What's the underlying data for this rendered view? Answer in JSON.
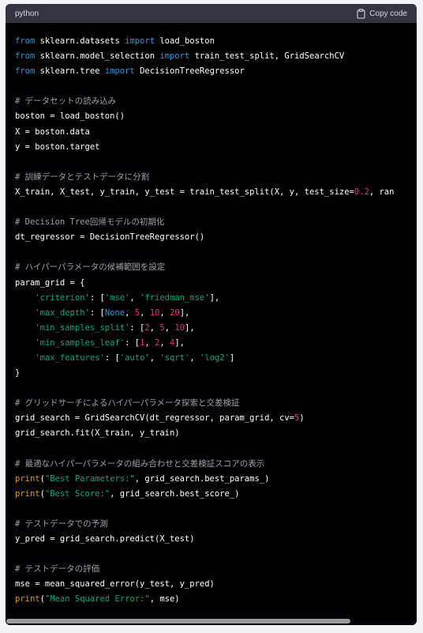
{
  "header": {
    "language": "python",
    "copy_label": "Copy code"
  },
  "colors": {
    "keyword": "#2e95d3",
    "string": "#00a67d",
    "number": "#df3079",
    "comment": "#a0a0aa",
    "builtin": "#e9950c",
    "text": "#ffffff",
    "header_bg": "#343541",
    "code_bg": "#000000"
  },
  "icons": {
    "copy": "clipboard-icon"
  },
  "code": {
    "lines": [
      [
        [
          "kw",
          "from"
        ],
        [
          "t",
          " sklearn.datasets "
        ],
        [
          "kw",
          "import"
        ],
        [
          "t",
          " load_boston"
        ]
      ],
      [
        [
          "kw",
          "from"
        ],
        [
          "t",
          " sklearn.model_selection "
        ],
        [
          "kw",
          "import"
        ],
        [
          "t",
          " train_test_split, GridSearchCV"
        ]
      ],
      [
        [
          "kw",
          "from"
        ],
        [
          "t",
          " sklearn.tree "
        ],
        [
          "kw",
          "import"
        ],
        [
          "t",
          " DecisionTreeRegressor"
        ]
      ],
      [],
      [
        [
          "cmt",
          "# データセットの読み込み"
        ]
      ],
      [
        [
          "t",
          "boston = load_boston()"
        ]
      ],
      [
        [
          "t",
          "X = boston.data"
        ]
      ],
      [
        [
          "t",
          "y = boston.target"
        ]
      ],
      [],
      [
        [
          "cmt",
          "# 訓練データとテストデータに分割"
        ]
      ],
      [
        [
          "t",
          "X_train, X_test, y_train, y_test = train_test_split(X, y, test_size="
        ],
        [
          "num",
          "0.2"
        ],
        [
          "t",
          ", ran"
        ]
      ],
      [],
      [
        [
          "cmt",
          "# Decision Tree回帰モデルの初期化"
        ]
      ],
      [
        [
          "t",
          "dt_regressor = DecisionTreeRegressor()"
        ]
      ],
      [],
      [
        [
          "cmt",
          "# ハイパーパラメータの候補範囲を設定"
        ]
      ],
      [
        [
          "t",
          "param_grid = {"
        ]
      ],
      [
        [
          "t",
          "    "
        ],
        [
          "str",
          "'criterion'"
        ],
        [
          "t",
          ": ["
        ],
        [
          "str",
          "'mse'"
        ],
        [
          "t",
          ", "
        ],
        [
          "str",
          "'friedman_mse'"
        ],
        [
          "t",
          "],"
        ]
      ],
      [
        [
          "t",
          "    "
        ],
        [
          "str",
          "'max_depth'"
        ],
        [
          "t",
          ": ["
        ],
        [
          "kw",
          "None"
        ],
        [
          "t",
          ", "
        ],
        [
          "num",
          "5"
        ],
        [
          "t",
          ", "
        ],
        [
          "num",
          "10"
        ],
        [
          "t",
          ", "
        ],
        [
          "num",
          "20"
        ],
        [
          "t",
          "],"
        ]
      ],
      [
        [
          "t",
          "    "
        ],
        [
          "str",
          "'min_samples_split'"
        ],
        [
          "t",
          ": ["
        ],
        [
          "num",
          "2"
        ],
        [
          "t",
          ", "
        ],
        [
          "num",
          "5"
        ],
        [
          "t",
          ", "
        ],
        [
          "num",
          "10"
        ],
        [
          "t",
          "],"
        ]
      ],
      [
        [
          "t",
          "    "
        ],
        [
          "str",
          "'min_samples_leaf'"
        ],
        [
          "t",
          ": ["
        ],
        [
          "num",
          "1"
        ],
        [
          "t",
          ", "
        ],
        [
          "num",
          "2"
        ],
        [
          "t",
          ", "
        ],
        [
          "num",
          "4"
        ],
        [
          "t",
          "],"
        ]
      ],
      [
        [
          "t",
          "    "
        ],
        [
          "str",
          "'max_features'"
        ],
        [
          "t",
          ": ["
        ],
        [
          "str",
          "'auto'"
        ],
        [
          "t",
          ", "
        ],
        [
          "str",
          "'sqrt'"
        ],
        [
          "t",
          ", "
        ],
        [
          "str",
          "'log2'"
        ],
        [
          "t",
          "]"
        ]
      ],
      [
        [
          "t",
          "}"
        ]
      ],
      [],
      [
        [
          "cmt",
          "# グリッドサーチによるハイパーパラメータ探索と交差検証"
        ]
      ],
      [
        [
          "t",
          "grid_search = GridSearchCV(dt_regressor, param_grid, cv="
        ],
        [
          "num",
          "5"
        ],
        [
          "t",
          ")"
        ]
      ],
      [
        [
          "t",
          "grid_search.fit(X_train, y_train)"
        ]
      ],
      [],
      [
        [
          "cmt",
          "# 最適なハイパーパラメータの組み合わせと交差検証スコアの表示"
        ]
      ],
      [
        [
          "fn",
          "print"
        ],
        [
          "t",
          "("
        ],
        [
          "str",
          "\"Best Parameters:\""
        ],
        [
          "t",
          ", grid_search.best_params_)"
        ]
      ],
      [
        [
          "fn",
          "print"
        ],
        [
          "t",
          "("
        ],
        [
          "str",
          "\"Best Score:\""
        ],
        [
          "t",
          ", grid_search.best_score_)"
        ]
      ],
      [],
      [
        [
          "cmt",
          "# テストデータでの予測"
        ]
      ],
      [
        [
          "t",
          "y_pred = grid_search.predict(X_test)"
        ]
      ],
      [],
      [
        [
          "cmt",
          "# テストデータの評価"
        ]
      ],
      [
        [
          "t",
          "mse = mean_squared_error(y_test, y_pred)"
        ]
      ],
      [
        [
          "fn",
          "print"
        ],
        [
          "t",
          "("
        ],
        [
          "str",
          "\"Mean Squared Error:\""
        ],
        [
          "t",
          ", mse)"
        ]
      ]
    ]
  }
}
